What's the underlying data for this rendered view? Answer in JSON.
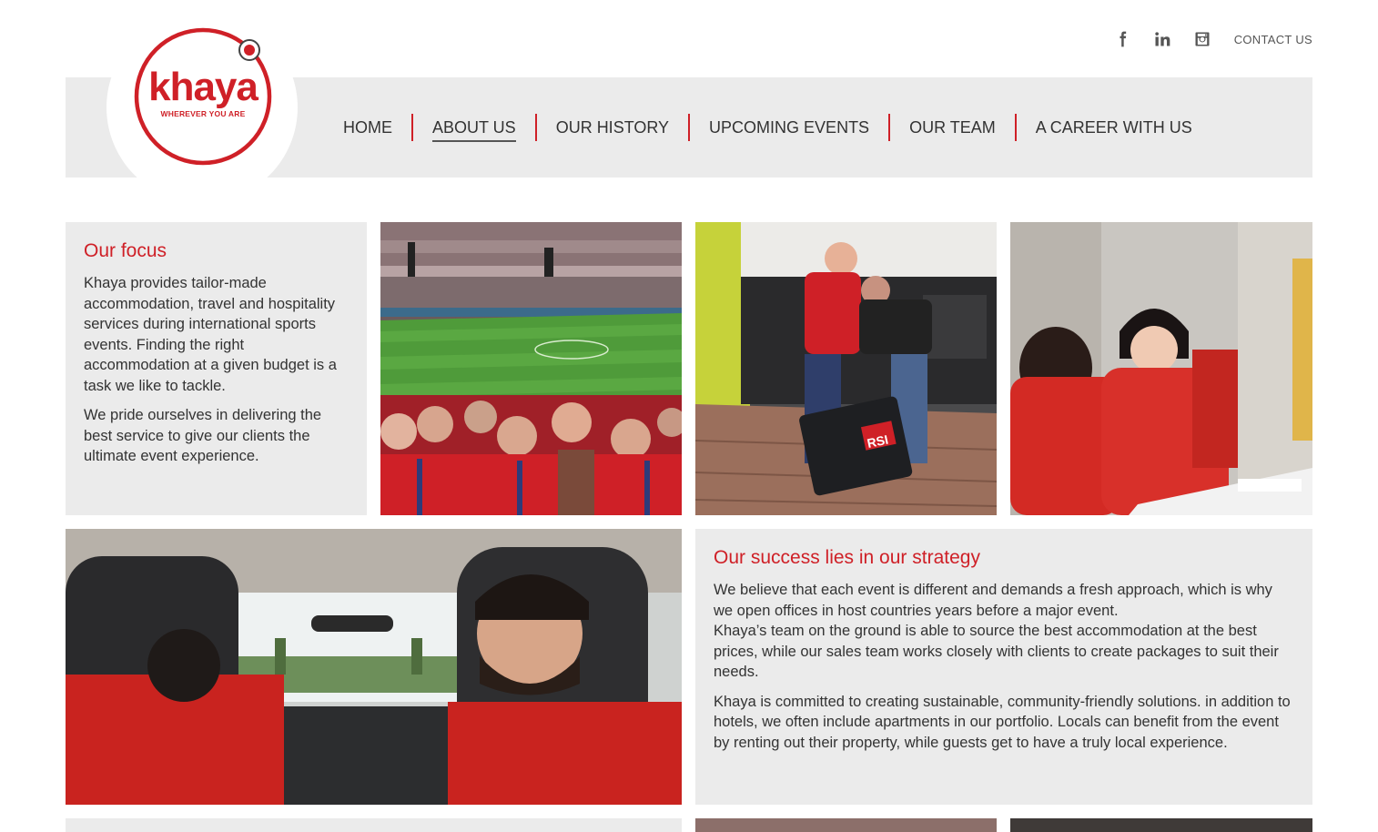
{
  "brand": {
    "name": "khaya",
    "tagline": "WHEREVER YOU ARE",
    "accent_color": "#cf2027"
  },
  "social": {
    "icons": [
      "facebook-icon",
      "linkedin-icon",
      "instagram-icon"
    ],
    "contact_label": "CONTACT US"
  },
  "nav": {
    "items": [
      "HOME",
      "ABOUT US",
      "OUR HISTORY",
      "UPCOMING EVENTS",
      "OUR TEAM",
      "A CAREER WITH US"
    ],
    "active": "ABOUT US"
  },
  "focus": {
    "title": "Our focus",
    "p1": "Khaya provides tailor-made accommodation, travel and hospitality services during international sports events. Finding the right accommodation at a given budget is a task we like to tackle.",
    "p2": "We pride ourselves in delivering the best service to give our clients the ultimate event experience."
  },
  "strategy": {
    "title": "Our success lies in our strategy",
    "p1": "We believe that each event is different and demands a fresh approach, which is why we open offices in host countries years before a major event.",
    "p2": "Khaya’s team on the ground is able to source the best accommodation at the best prices, while our sales team works closely with clients to create packages to suit their needs.",
    "p3": "Khaya is committed to creating sustainable, community-friendly solutions. in addition to hotels, we often include apartments in our portfolio. Locals can benefit from the event by renting out their property, while guests get to have a truly local experience."
  },
  "photos": {
    "luggage_badge": "RSI"
  }
}
